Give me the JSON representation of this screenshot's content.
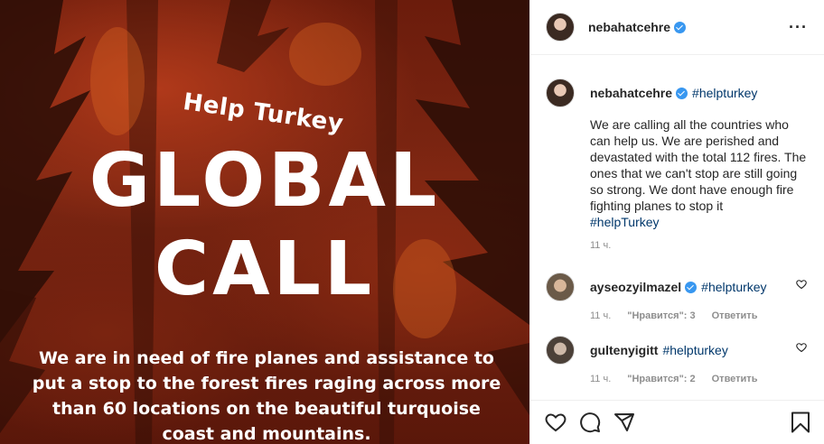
{
  "post_image": {
    "subtitle": "Help Turkey",
    "headline_1": "GLOBAL",
    "headline_2": "CALL",
    "body": "We are in need of fire planes and assistance to put a stop to the forest fires raging across more than 60 locations on the beautiful turquoise coast and mountains."
  },
  "header": {
    "username": "nebahatcehre",
    "more": "···"
  },
  "caption": {
    "username": "nebahatcehre",
    "hashtag": "#helpturkey",
    "text": "We are calling all the countries who can help us. We are perished and devastated with the total 112 fires. The ones that we can't stop are still going so strong. We dont have enough fire fighting planes to stop it",
    "tag": "#helpTurkey",
    "time": "11 ч."
  },
  "comments": [
    {
      "username": "ayseozyilmazel",
      "hashtag": "#helpturkey",
      "time": "11 ч.",
      "likes": "\"Нравится\": 3",
      "reply": "Ответить"
    },
    {
      "username": "gultenyigitt",
      "hashtag": "#helpturkey",
      "time": "11 ч.",
      "likes": "\"Нравится\": 2",
      "reply": "Ответить"
    }
  ],
  "icons": {
    "like": "heart-icon",
    "comment": "comment-icon",
    "share": "share-icon",
    "save": "bookmark-icon",
    "verified": "verified-badge-icon"
  },
  "colors": {
    "link": "#00376b",
    "verified": "#3897f0",
    "meta": "#8e8e8e"
  }
}
